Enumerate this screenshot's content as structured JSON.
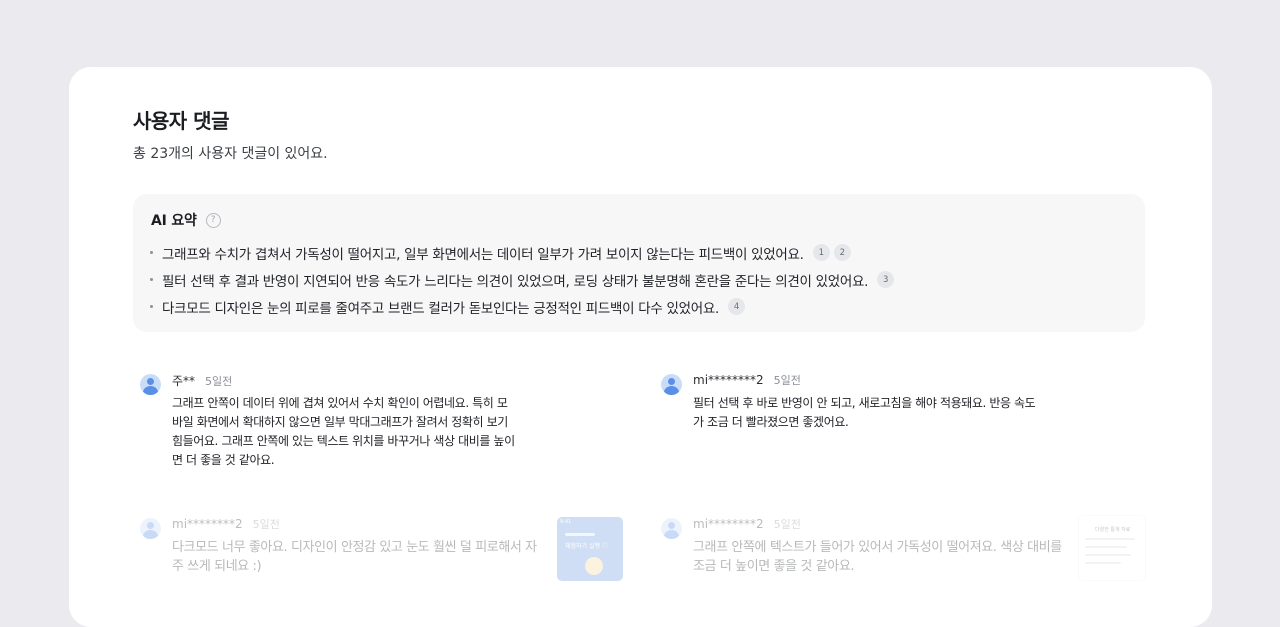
{
  "section": {
    "title": "사용자 댓글",
    "subtitle": "총 23개의 사용자 댓글이 있어요."
  },
  "ai_summary": {
    "title": "AI 요약",
    "help_icon": "question-circle-icon",
    "items": [
      {
        "text": "그래프와 수치가 겹쳐서 가독성이 떨어지고, 일부 화면에서는 데이터 일부가 가려 보이지 않는다는 피드백이 있었어요.",
        "refs": [
          "1",
          "2"
        ]
      },
      {
        "text": "필터 선택 후 결과 반영이 지연되어 반응 속도가 느리다는 의견이 있었으며, 로딩 상태가 불분명해 혼란을 준다는 의견이 있었어요.",
        "refs": [
          "3"
        ]
      },
      {
        "text": "다크모드 디자인은 눈의 피로를 줄여주고 브랜드 컬러가 돋보인다는 긍정적인 피드백이 다수 있었어요.",
        "refs": [
          "4"
        ]
      }
    ]
  },
  "comments": [
    {
      "author": "주**",
      "date": "5일전",
      "lines": [
        "그래프 안쪽이 데이터 위에 겹쳐 있어서 수치 확인이 어렵네요. 특히 모",
        "바일 화면에서 확대하지 않으면 일부 막대그래프가 잘려서 정확히 보기",
        "힘들어요. 그래프 안쪽에 있는 텍스트 위치를 바꾸거나 색상 대비를 높이",
        "면 더 좋을 것 같아요."
      ]
    },
    {
      "author": "mi********2",
      "date": "5일전",
      "lines": [
        "필터 선택 후 바로 반영이 안 되고, 새로고침을 해야 적용돼요. 반응 속도",
        "가 조금 더 빨라졌으면 좋겠어요."
      ]
    },
    {
      "author": "mi********2",
      "date": "5일전",
      "lines": [
        "다크모드 너무 좋아요. 디자인이 안정감 있고 눈도 훨씬 덜 피로해서 자",
        "주 쓰게 되네요 :)"
      ],
      "thumbnail": {
        "time": "9:41",
        "text": "체험하기 실행 ⓘ"
      }
    },
    {
      "author": "mi********2",
      "date": "5일전",
      "lines": [
        "그래프 안쪽에 텍스트가 들어가 있어서 가독성이 떨어져요. 색상 대비를",
        "조금 더 높이면 좋을 것 같아요."
      ],
      "thumbnail": {
        "text": "다양한 통계 자료"
      }
    }
  ],
  "colors": {
    "page_bg": "#ebebef",
    "card_bg": "#ffffff",
    "summary_bg": "#f7f7f8",
    "avatar_accent": "#5b8fe6"
  }
}
